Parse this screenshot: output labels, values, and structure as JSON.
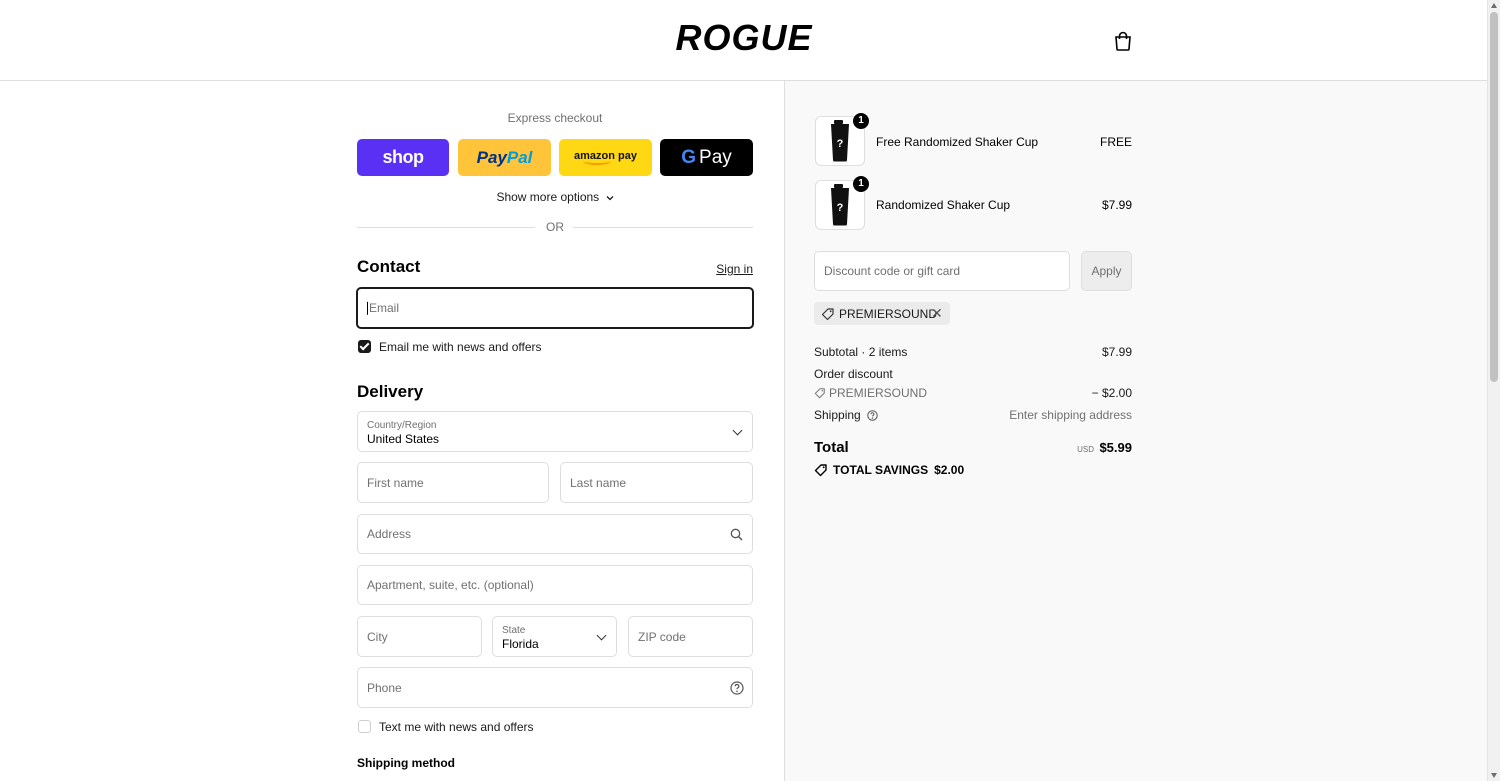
{
  "brand": {
    "logo_text": "ROGUE"
  },
  "express": {
    "title": "Express checkout",
    "shop_label": "shop",
    "paypal_label_1": "Pay",
    "paypal_label_2": "Pal",
    "amazon_label": "amazon pay",
    "gpay_g": "G",
    "gpay_label": "Pay",
    "show_more": "Show more options",
    "or": "OR"
  },
  "contact": {
    "title": "Contact",
    "sign_in": "Sign in",
    "email_placeholder": "Email",
    "email_news_label": "Email me with news and offers",
    "email_news_checked": true
  },
  "delivery": {
    "title": "Delivery",
    "country_label": "Country/Region",
    "country_value": "United States",
    "first_name_placeholder": "First name",
    "last_name_placeholder": "Last name",
    "address_placeholder": "Address",
    "apartment_placeholder": "Apartment, suite, etc. (optional)",
    "city_placeholder": "City",
    "state_label": "State",
    "state_value": "Florida",
    "zip_placeholder": "ZIP code",
    "phone_placeholder": "Phone",
    "text_news_label": "Text me with news and offers",
    "text_news_checked": false
  },
  "shipping_method": {
    "title": "Shipping method"
  },
  "order": {
    "items": [
      {
        "name": "Free Randomized Shaker Cup",
        "price": "FREE",
        "qty": "1",
        "thumb_icon": "shaker-cup-icon"
      },
      {
        "name": "Randomized Shaker Cup",
        "price": "$7.99",
        "qty": "1",
        "thumb_icon": "shaker-cup-icon"
      }
    ],
    "discount_placeholder": "Discount code or gift card",
    "apply_label": "Apply",
    "applied_code": "PREMIERSOUND",
    "subtotal_label": "Subtotal · 2 items",
    "subtotal_value": "$7.99",
    "order_discount_label": "Order discount",
    "discount_code": "PREMIERSOUND",
    "discount_value": "− $2.00",
    "shipping_label": "Shipping",
    "shipping_value": "Enter shipping address",
    "total_label": "Total",
    "total_currency": "USD",
    "total_value": "$5.99",
    "savings_label": "TOTAL SAVINGS",
    "savings_value": "$2.00"
  },
  "colors": {
    "shop": "#5a31f4",
    "paypal": "#ffc439",
    "amazon": "#ffd814",
    "gpay": "#000000",
    "summary_bg": "#f9f9f9"
  }
}
